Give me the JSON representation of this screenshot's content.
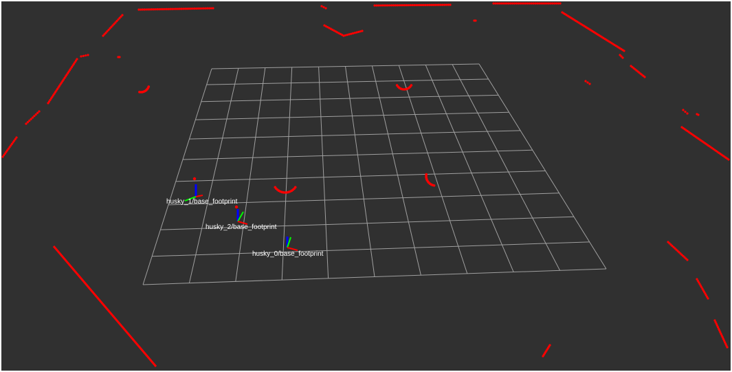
{
  "scene": {
    "background_color": "#303030",
    "grid_color": "#a0a0a0",
    "laser_color": "#ff0000",
    "axis_colors": {
      "x": "#ff0000",
      "y": "#00ff00",
      "z": "#0000ff"
    },
    "grid_cells": 10
  },
  "frames": [
    {
      "id": "husky_1",
      "label": "husky_1/base_footprint"
    },
    {
      "id": "husky_2",
      "label": "husky_2/base_footprint"
    },
    {
      "id": "husky_0",
      "label": "husky_0/base_footprint"
    }
  ]
}
